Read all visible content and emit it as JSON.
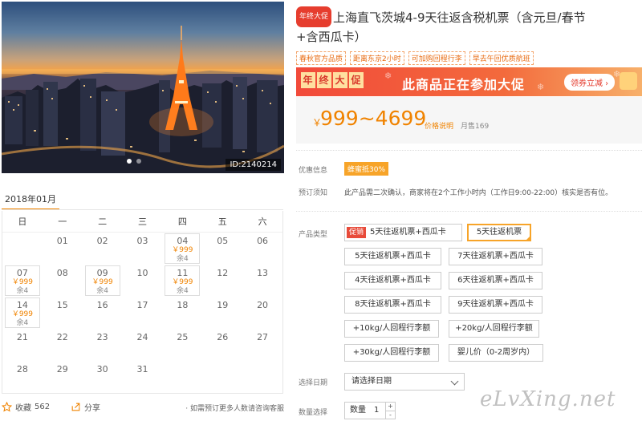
{
  "photo": {
    "image_id": "ID:2140214",
    "slides": 2,
    "active_slide": 0
  },
  "calendar": {
    "month": "2018年01月",
    "weekdays": [
      "日",
      "一",
      "二",
      "三",
      "四",
      "五",
      "六"
    ],
    "leading_blanks": 1,
    "days": [
      {
        "d": "01"
      },
      {
        "d": "02"
      },
      {
        "d": "03"
      },
      {
        "d": "04",
        "price": "￥999",
        "remain": "余4"
      },
      {
        "d": "05"
      },
      {
        "d": "06"
      },
      {
        "d": "07",
        "price": "￥999",
        "remain": "余4"
      },
      {
        "d": "08"
      },
      {
        "d": "09",
        "price": "￥999",
        "remain": "余4"
      },
      {
        "d": "10"
      },
      {
        "d": "11",
        "price": "￥999",
        "remain": "余4"
      },
      {
        "d": "12"
      },
      {
        "d": "13"
      },
      {
        "d": "14",
        "price": "￥999",
        "remain": "余4"
      },
      {
        "d": "15"
      },
      {
        "d": "16"
      },
      {
        "d": "17"
      },
      {
        "d": "18"
      },
      {
        "d": "19"
      },
      {
        "d": "20"
      },
      {
        "d": "21"
      },
      {
        "d": "22"
      },
      {
        "d": "23"
      },
      {
        "d": "24"
      },
      {
        "d": "25"
      },
      {
        "d": "26"
      },
      {
        "d": "27"
      },
      {
        "d": "28"
      },
      {
        "d": "29"
      },
      {
        "d": "30"
      },
      {
        "d": "31"
      }
    ]
  },
  "footer": {
    "favorite_label": "收藏",
    "favorite_count": "562",
    "share_label": "分享",
    "note": "· 如需预订更多人数请咨询客服"
  },
  "product": {
    "badge": "年终大促",
    "title_line1": "上海直飞茨城4-9天往返含税机票（含元旦/春节",
    "title_line2": "+含西瓜卡）",
    "tags": [
      "春秋官方品质",
      "距离东京2小时",
      "可加购回程行李",
      "早去午回优质航班"
    ]
  },
  "promo": {
    "chars": [
      "年",
      "终",
      "大",
      "促"
    ],
    "text": "此商品正在参加大促",
    "button": "领券立减 ›"
  },
  "price": {
    "currency": "￥",
    "range": "999~4699",
    "explain": "价格说明",
    "sold": "月售169"
  },
  "info": {
    "discount_label": "优惠信息",
    "discount_value": "蜂蜜抵30%",
    "notice_label": "预订须知",
    "notice_text": "此产品需二次确认，商家将在2个工作小时内（工作日9:00-22:00）核实是否有位。"
  },
  "options": {
    "label": "产品类型",
    "promo_tag": "促销",
    "items": [
      "5天往返机票+西瓜卡",
      "5天往返机票",
      "5天往返机票+西瓜卡",
      "7天往返机票+西瓜卡",
      "4天往返机票+西瓜卡",
      "6天往返机票+西瓜卡",
      "8天往返机票+西瓜卡",
      "9天往返机票+西瓜卡",
      "+10kg/人回程行李额",
      "+20kg/人回程行李额",
      "+30kg/人回程行李额",
      "婴儿价（0-2周岁内）"
    ],
    "selected_index": 1
  },
  "date_select": {
    "label": "选择日期",
    "placeholder": "请选择日期"
  },
  "quantity": {
    "label": "数量选择",
    "prefix": "数量",
    "value": "1",
    "plus": "+",
    "minus": "-"
  },
  "watermark": "eLvXing.net",
  "colors": {
    "accent": "#f08300",
    "promo_red": "#e63d2e",
    "selected_border": "#f7a429"
  }
}
